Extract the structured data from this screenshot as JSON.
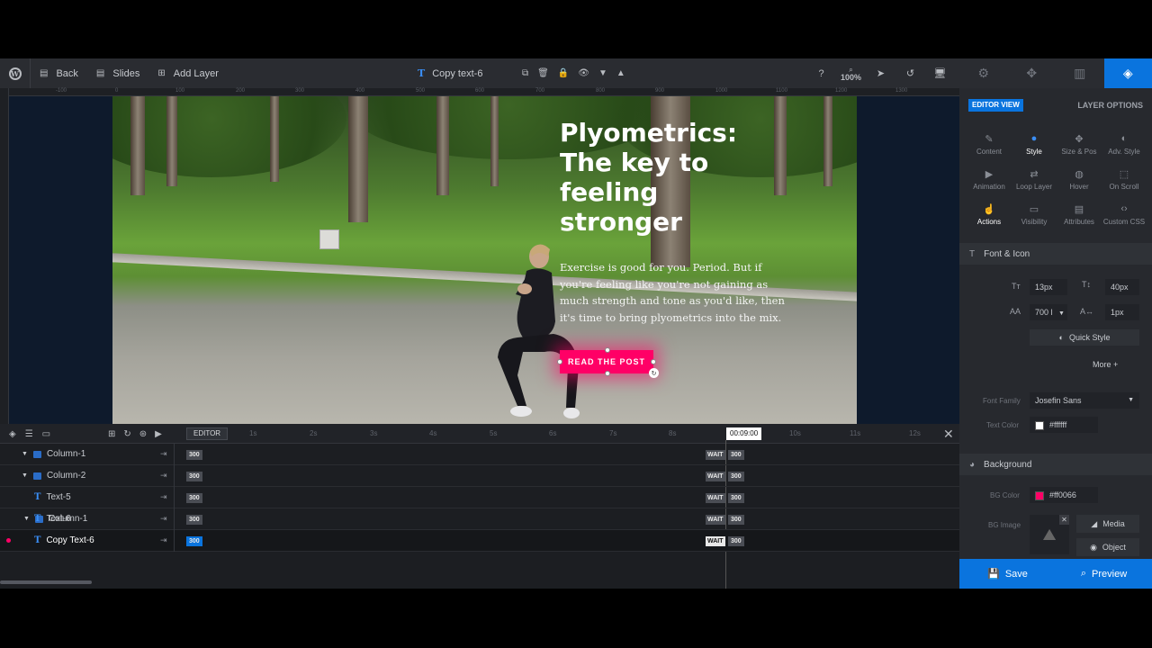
{
  "toolbar": {
    "back_label": "Back",
    "slides_label": "Slides",
    "add_layer_label": "Add Layer",
    "layer_name": "Copy text-6",
    "zoom": "100%"
  },
  "ruler": [
    "-100",
    "0",
    "100",
    "200",
    "300",
    "400",
    "500",
    "600",
    "700",
    "800",
    "900",
    "1000",
    "1100",
    "1200",
    "1300"
  ],
  "slide": {
    "headline": "Plyometrics: The key to feeling stronger",
    "body": "Exercise is good for you. Period. But if you're feeling like you're not gaining as much strength and tone as you'd like, then it's time to bring plyometrics into the mix.",
    "cta": "READ THE POST"
  },
  "timeline": {
    "editor_label": "EDITOR",
    "current_time": "00:09:00",
    "ticks": [
      "1s",
      "2s",
      "3s",
      "4s",
      "5s",
      "6s",
      "7s",
      "8s",
      "9s",
      "10s",
      "11s",
      "12s"
    ],
    "rows": [
      {
        "label": "Column-1",
        "start": "300",
        "wait": "WAIT",
        "end": "300"
      },
      {
        "label": "Column-2",
        "start": "300",
        "wait": "WAIT",
        "end": "300"
      },
      {
        "label": "Text-5",
        "start": "300",
        "wait": "WAIT",
        "end": "300"
      },
      {
        "label": "Text-6",
        "start": "300",
        "wait": "WAIT",
        "end": "300"
      },
      {
        "label": "Copy Text-6",
        "start": "300",
        "wait": "WAIT",
        "end": "300"
      }
    ]
  },
  "panel": {
    "editor_view": "EDITOR VIEW",
    "layer_options": "LAYER OPTIONS",
    "options": [
      {
        "label": "Content",
        "icon": "pencil-icon"
      },
      {
        "label": "Style",
        "icon": "palette-icon"
      },
      {
        "label": "Size & Pos",
        "icon": "move-icon"
      },
      {
        "label": "Adv. Style",
        "icon": "contrast-icon"
      },
      {
        "label": "Animation",
        "icon": "play-icon"
      },
      {
        "label": "Loop Layer",
        "icon": "loop-icon"
      },
      {
        "label": "Hover",
        "icon": "mouse-icon"
      },
      {
        "label": "On Scroll",
        "icon": "scroll-icon"
      },
      {
        "label": "Actions",
        "icon": "hand-icon"
      },
      {
        "label": "Visibility",
        "icon": "visibility-icon"
      },
      {
        "label": "Attributes",
        "icon": "file-icon"
      },
      {
        "label": "Custom CSS",
        "icon": "code-icon"
      }
    ],
    "font_section": "Font & Icon",
    "font_size": "13px",
    "line_height": "40px",
    "font_weight": "700 l",
    "letter_spacing": "1px",
    "quick_style": "Quick Style",
    "more": "More",
    "font_family_label": "Font Family",
    "font_family": "Josefin Sans",
    "text_color_label": "Text Color",
    "text_color": "#ffffff",
    "bg_section": "Background",
    "bg_color_label": "BG Color",
    "bg_color": "#ff0066",
    "bg_image_label": "BG Image",
    "media": "Media",
    "object": "Object",
    "save": "Save",
    "preview": "Preview"
  }
}
